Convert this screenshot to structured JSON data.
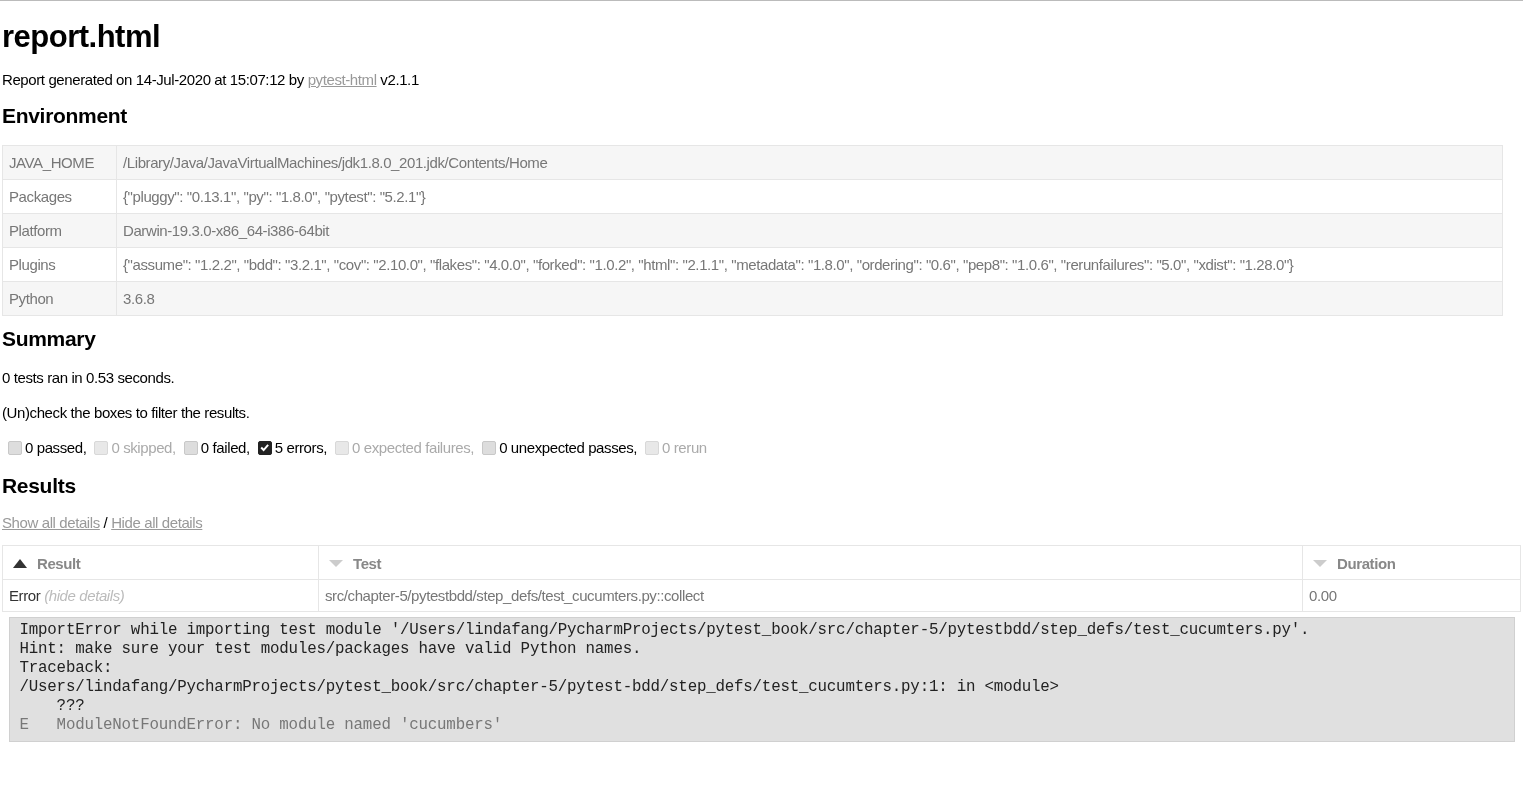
{
  "title": "report.html",
  "generated": {
    "before": "Report generated on 14-Jul-2020 at 15:07:12 by",
    "link": "pytest-html",
    "after": "v2.1.1"
  },
  "environment": {
    "heading": "Environment",
    "rows": [
      {
        "key": "JAVA_HOME",
        "value": "/Library/Java/JavaVirtualMachines/jdk1.8.0_201.jdk/Contents/Home"
      },
      {
        "key": "Packages",
        "value": "{\"pluggy\": \"0.13.1\", \"py\": \"1.8.0\", \"pytest\": \"5.2.1\"}"
      },
      {
        "key": "Platform",
        "value": "Darwin-19.3.0-x86_64-i386-64bit"
      },
      {
        "key": "Plugins",
        "value": "{\"assume\": \"1.2.2\", \"bdd\": \"3.2.1\", \"cov\": \"2.10.0\", \"flakes\": \"4.0.0\", \"forked\": \"1.0.2\", \"html\": \"2.1.1\", \"metadata\": \"1.8.0\", \"ordering\": \"0.6\", \"pep8\": \"1.0.6\", \"rerunfailures\": \"5.0\", \"xdist\": \"1.28.0\"}"
      },
      {
        "key": "Python",
        "value": "3.6.8"
      }
    ]
  },
  "summary": {
    "heading": "Summary",
    "ran": "0 tests ran in 0.53 seconds.",
    "hint": "(Un)check the boxes to filter the results.",
    "filters": [
      {
        "label": "0 passed,",
        "checked": false,
        "disabled": false
      },
      {
        "label": "0 skipped,",
        "checked": false,
        "disabled": true
      },
      {
        "label": "0 failed,",
        "checked": false,
        "disabled": false
      },
      {
        "label": "5 errors,",
        "checked": true,
        "disabled": false
      },
      {
        "label": "0 expected failures,",
        "checked": false,
        "disabled": true
      },
      {
        "label": "0 unexpected passes,",
        "checked": false,
        "disabled": false
      },
      {
        "label": "0 rerun",
        "checked": false,
        "disabled": true
      }
    ]
  },
  "results": {
    "heading": "Results",
    "show_all": "Show all details",
    "separator": "/",
    "hide_all": "Hide all details",
    "columns": [
      {
        "label": "Result",
        "sorted": true
      },
      {
        "label": "Test",
        "sorted": false
      },
      {
        "label": "Duration",
        "sorted": false
      }
    ],
    "rows": [
      {
        "result": "Error",
        "toggle": "(hide details)",
        "test": "src/chapter-5/pytestbdd/step_defs/test_cucumters.py::collect",
        "duration": "0.00",
        "log": [
          {
            "kind": "plain",
            "text": "ImportError while importing test module '/Users/lindafang/PycharmProjects/pytest_book/src/chapter-5/pytestbdd/step_defs/test_cucumters.py'."
          },
          {
            "kind": "plain",
            "text": "Hint: make sure your test modules/packages have valid Python names."
          },
          {
            "kind": "plain",
            "text": "Traceback:"
          },
          {
            "kind": "plain",
            "text": "/Users/lindafang/PycharmProjects/pytest_book/src/chapter-5/pytest-bdd/step_defs/test_cucumters.py:1: in <module>"
          },
          {
            "kind": "plain",
            "text": "    ???"
          },
          {
            "kind": "error",
            "text": "E   ModuleNotFoundError: No module named 'cucumbers'"
          }
        ]
      }
    ]
  }
}
